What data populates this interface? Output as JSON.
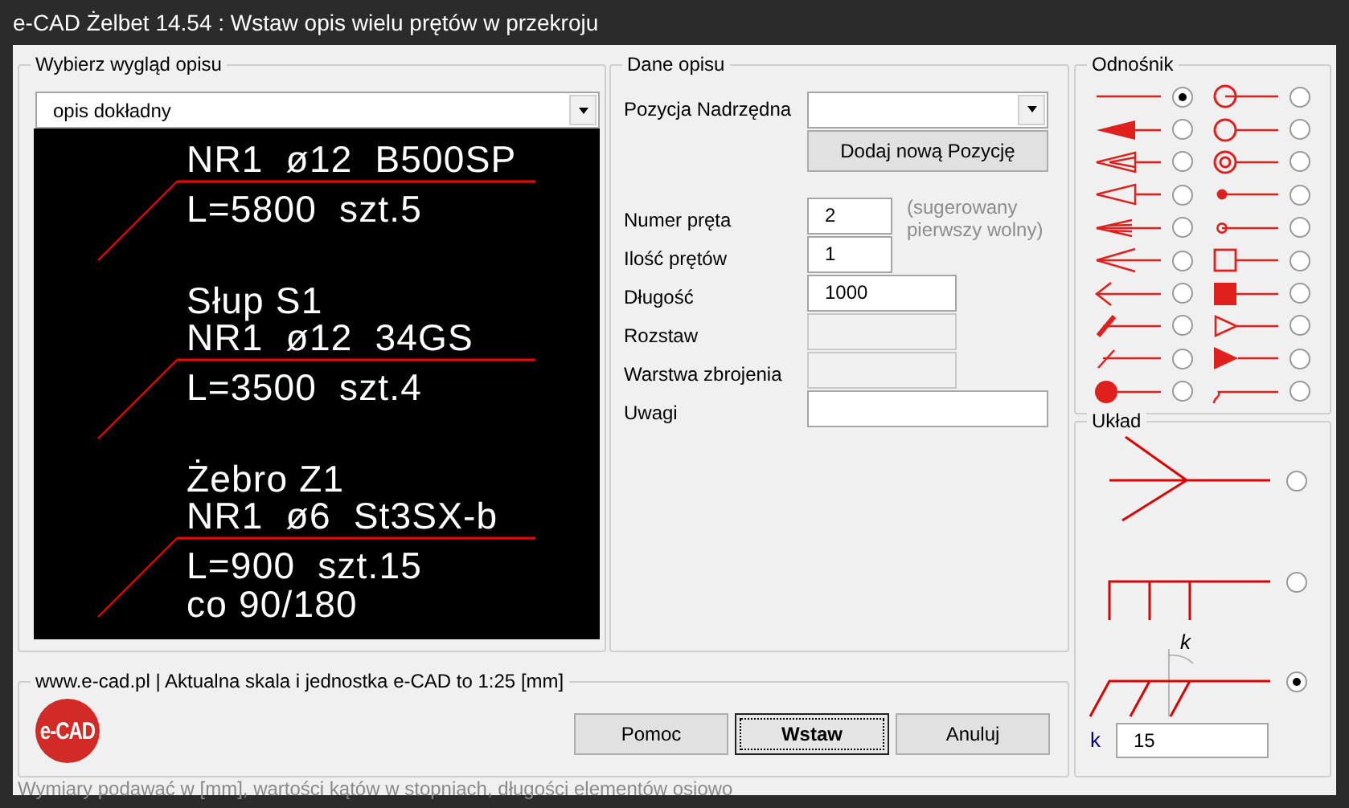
{
  "window": {
    "title": "e-CAD Żelbet 14.54 : Wstaw opis wielu prętów w przekroju"
  },
  "appearance": {
    "title": "Wybierz wygląd opisu",
    "style": "opis dokładny",
    "preview": [
      {
        "above": [
          "NR1  ø12  B500SP"
        ],
        "below": [
          "L=5800  szt.5"
        ]
      },
      {
        "above": [
          "Słup S1",
          "NR1  ø12  34GS"
        ],
        "below": [
          "L=3500  szt.4"
        ]
      },
      {
        "above": [
          "Żebro Z1",
          "NR1  ø6  St3SX-b"
        ],
        "below": [
          "L=900  szt.15",
          "co 90/180"
        ]
      }
    ]
  },
  "details": {
    "title": "Dane opisu",
    "parent_label": "Pozycja Nadrzędna",
    "add_button": "Dodaj nową Pozycję",
    "fields": [
      {
        "label": "Numer pręta",
        "value": "2",
        "disabled": false,
        "hint": "(sugerowany pierwszy wolny)"
      },
      {
        "label": "Ilość prętów",
        "value": "1",
        "disabled": false
      },
      {
        "label": "Długość",
        "value": "1000",
        "disabled": false
      },
      {
        "label": "Rozstaw",
        "disabled": true
      },
      {
        "label": "Warstwa zbrojenia",
        "disabled": true
      },
      {
        "label": "Uwagi",
        "disabled": false
      }
    ]
  },
  "leader": {
    "title": "Odnośnik",
    "styles": [
      {
        "kind": "line",
        "selected": true
      },
      {
        "kind": "crossed-circle",
        "selected": false
      },
      {
        "kind": "filled-arrow",
        "selected": false
      },
      {
        "kind": "circle",
        "selected": false
      },
      {
        "kind": "double-open-arrow",
        "selected": false
      },
      {
        "kind": "double-circle",
        "selected": false
      },
      {
        "kind": "open-arrow",
        "selected": false
      },
      {
        "kind": "small-dot",
        "selected": false
      },
      {
        "kind": "double-line-arrow",
        "selected": false
      },
      {
        "kind": "small-circle",
        "selected": false
      },
      {
        "kind": "line-arrow",
        "selected": false
      },
      {
        "kind": "square",
        "selected": false
      },
      {
        "kind": "chevron",
        "selected": false
      },
      {
        "kind": "filled-square",
        "selected": false
      },
      {
        "kind": "thick-tick",
        "selected": false
      },
      {
        "kind": "open-triangle",
        "selected": false
      },
      {
        "kind": "tick",
        "selected": false
      },
      {
        "kind": "filled-triangle",
        "selected": false
      },
      {
        "kind": "large-dot",
        "selected": false
      },
      {
        "kind": "hook",
        "selected": false
      }
    ]
  },
  "layout": {
    "title": "Układ",
    "options": [
      {
        "kind": "fan",
        "selected": false
      },
      {
        "kind": "comb",
        "selected": false
      },
      {
        "kind": "skewed",
        "selected": true,
        "angle_label": "k"
      }
    ],
    "k_label": "k",
    "k_value": "15"
  },
  "footer": {
    "title": "www.e-cad.pl | Aktualna skala i jednostka e-CAD to 1:25 [mm]",
    "logo": "e-CAD",
    "buttons": [
      {
        "label": "Pomoc",
        "default": false
      },
      {
        "label": "Wstaw",
        "default": true
      },
      {
        "label": "Anuluj",
        "default": false
      }
    ]
  },
  "status_bar": "Wymiary podawać w [mm], wartości kątów w stopniach, długości elementów osiowo"
}
